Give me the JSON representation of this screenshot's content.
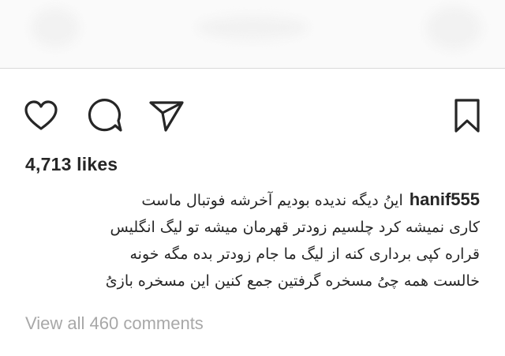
{
  "actions": {
    "like_icon": "heart-outline-icon",
    "comment_icon": "comment-bubble-icon",
    "share_icon": "paper-plane-icon",
    "save_icon": "bookmark-outline-icon"
  },
  "likes_text": "4,713 likes",
  "caption": {
    "username": "hanif555",
    "line1": "اینُ دیگه ندیده بودیم آخرشه  فوتبال ماست",
    "line2": "کاری نمیشه کرد چلسیم زودتر قهرمان میشه تو لیگ انگلیس",
    "line3": "قراره کپی برداری کنه از لیگ ما جام زودتر بده مگه خونه",
    "line4": "خالست همه چیُ مسخره گرفتین جمع کنین این مسخره بازیُ"
  },
  "view_all_comments": "View all 460 comments",
  "colors": {
    "text": "#262626",
    "muted": "#a8a8a8",
    "divider": "#d9d9d9",
    "top_bg": "#fafafa"
  }
}
